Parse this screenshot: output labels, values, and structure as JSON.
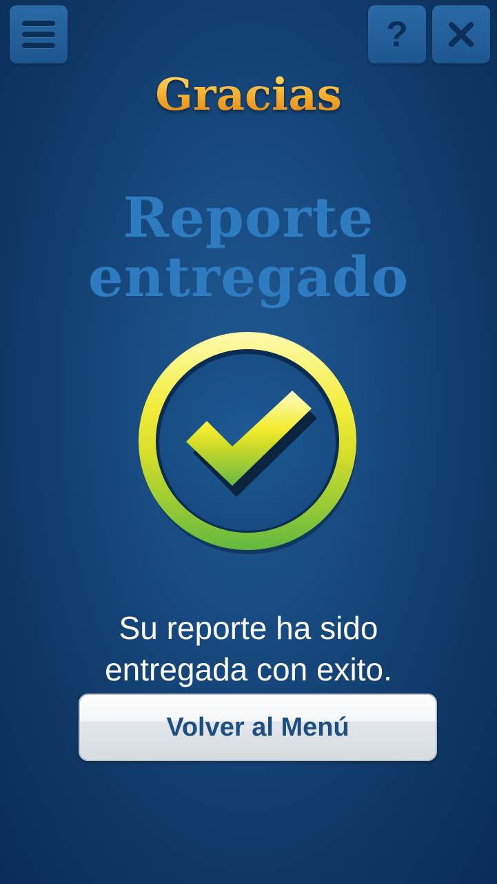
{
  "header": {
    "menu_icon": "hamburger-menu-icon",
    "help_icon": "question-mark-icon",
    "help_label": "?",
    "close_icon": "close-x-icon",
    "title": "Gracias"
  },
  "main": {
    "headline_line1": "Reporte",
    "headline_line2": "entregado",
    "status_icon": "checkmark-circle-icon",
    "message_line1": "Su reporte ha sido",
    "message_line2": "entregada con exito.",
    "back_button_label": "Volver al Menú"
  },
  "colors": {
    "background": "#174a80",
    "title_gold": "#f2a01a",
    "headline_blue": "#2f7bc0",
    "check_yellow": "#f5ee3c",
    "check_green": "#6cbf3f",
    "button_text": "#1d4f80"
  }
}
